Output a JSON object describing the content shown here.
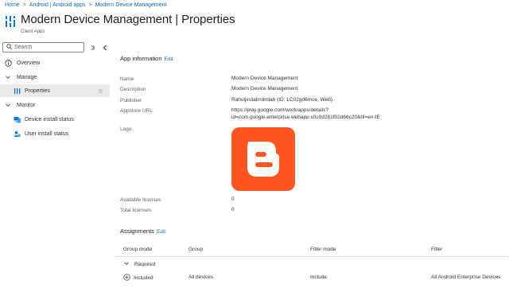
{
  "breadcrumb": {
    "items": [
      "Home",
      "Android | Android apps",
      "Modern Device Management"
    ],
    "separator": ">"
  },
  "header": {
    "title": "Modern Device Management | Properties",
    "subtitle": "Client Apps",
    "icon": "client-apps-icon"
  },
  "sidebar": {
    "search_placeholder": "Search",
    "search_value": "",
    "items": [
      {
        "label": "Overview",
        "icon": "info-icon"
      },
      {
        "label": "Manage",
        "icon": "chevron-down-icon"
      },
      {
        "label": "Properties",
        "icon": "properties-icon",
        "selected": true
      },
      {
        "label": "Monitor",
        "icon": "chevron-down-icon"
      },
      {
        "label": "Device install status",
        "icon": "device-icon"
      },
      {
        "label": "User install status",
        "icon": "user-icon"
      }
    ]
  },
  "app_info": {
    "title": "App information",
    "edit_label": "Edit",
    "fields": [
      {
        "label": "Name",
        "value": "Modern Device Management"
      },
      {
        "label": "Description",
        "value": "Modern Device Management"
      },
      {
        "label": "Publisher",
        "value": "Rahuljindalmdmlab (ID: LC02gd6mce, Web)"
      },
      {
        "label": "Appstore URL",
        "value_line1": "https://play.google.com/work/apps/details?",
        "value_line2": "id=com.google.enterprise.webapp.x0c0d281f02d66c20&hl=en-IE"
      },
      {
        "label": "Logo",
        "value": "blogger-logo"
      },
      {
        "label": "Available licenses",
        "value": "0"
      },
      {
        "label": "Total licenses",
        "value": "0"
      }
    ]
  },
  "assignments": {
    "title": "Assignments",
    "edit_label": "Edit",
    "columns": [
      "Group mode",
      "Group",
      "Filter mode",
      "Filter"
    ],
    "group_label": "Required",
    "rows": [
      {
        "group_mode": "Included",
        "group": "All devices",
        "filter_mode": "Include",
        "filter": "All Android Enterprise Devices"
      }
    ]
  },
  "colors": {
    "accent": "#0f6cbd",
    "logo_bg": "#fe5722",
    "selected_bg": "#edebe9"
  }
}
